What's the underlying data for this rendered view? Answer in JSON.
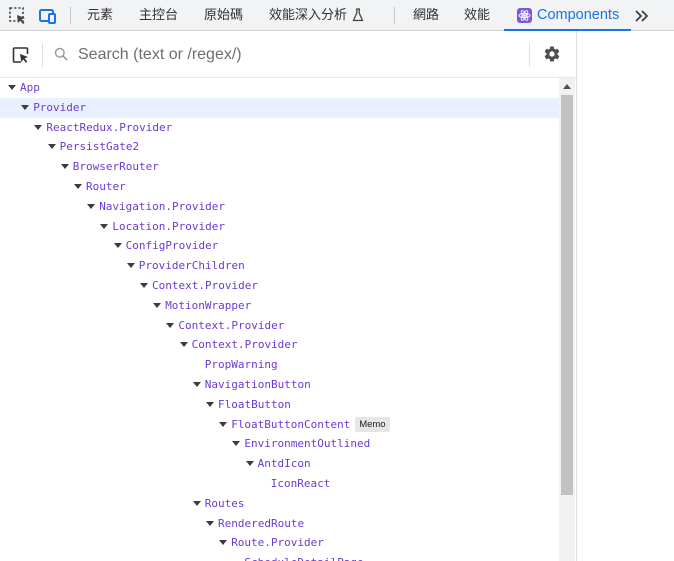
{
  "toolbar": {
    "tabs": [
      "元素",
      "主控台",
      "原始碼",
      "效能深入分析",
      "網路",
      "效能"
    ],
    "active_tab": "Components",
    "accent_color": "#1a73e8",
    "icons": [
      "element-picker-icon",
      "device-toolbar-icon",
      "flask-icon",
      "react-icon",
      "more-tabs-chevron-icon"
    ]
  },
  "search": {
    "placeholder": "Search (text or /regex/)"
  },
  "tree": {
    "selected": "Provider",
    "nodes": [
      {
        "name": "App",
        "depth": 0,
        "expanded": true
      },
      {
        "name": "Provider",
        "depth": 1,
        "expanded": true
      },
      {
        "name": "ReactRedux.Provider",
        "depth": 2,
        "expanded": true
      },
      {
        "name": "PersistGate2",
        "depth": 3,
        "expanded": true
      },
      {
        "name": "BrowserRouter",
        "depth": 4,
        "expanded": true
      },
      {
        "name": "Router",
        "depth": 5,
        "expanded": true
      },
      {
        "name": "Navigation.Provider",
        "depth": 6,
        "expanded": true
      },
      {
        "name": "Location.Provider",
        "depth": 7,
        "expanded": true
      },
      {
        "name": "ConfigProvider",
        "depth": 8,
        "expanded": true
      },
      {
        "name": "ProviderChildren",
        "depth": 9,
        "expanded": true
      },
      {
        "name": "Context.Provider",
        "depth": 10,
        "expanded": true
      },
      {
        "name": "MotionWrapper",
        "depth": 11,
        "expanded": true
      },
      {
        "name": "Context.Provider",
        "depth": 12,
        "expanded": true
      },
      {
        "name": "Context.Provider",
        "depth": 13,
        "expanded": true
      },
      {
        "name": "PropWarning",
        "depth": 14,
        "expanded": false
      },
      {
        "name": "NavigationButton",
        "depth": 14,
        "expanded": true
      },
      {
        "name": "FloatButton",
        "depth": 15,
        "expanded": true
      },
      {
        "name": "FloatButtonContent",
        "depth": 16,
        "expanded": true,
        "badge": "Memo"
      },
      {
        "name": "EnvironmentOutlined",
        "depth": 17,
        "expanded": true
      },
      {
        "name": "AntdIcon",
        "depth": 18,
        "expanded": true
      },
      {
        "name": "IconReact",
        "depth": 19,
        "expanded": false
      },
      {
        "name": "Routes",
        "depth": 14,
        "expanded": true
      },
      {
        "name": "RenderedRoute",
        "depth": 15,
        "expanded": true
      },
      {
        "name": "Route.Provider",
        "depth": 16,
        "expanded": true
      },
      {
        "name": "ScheduleDetailPage",
        "depth": 17,
        "expanded": false
      }
    ]
  }
}
